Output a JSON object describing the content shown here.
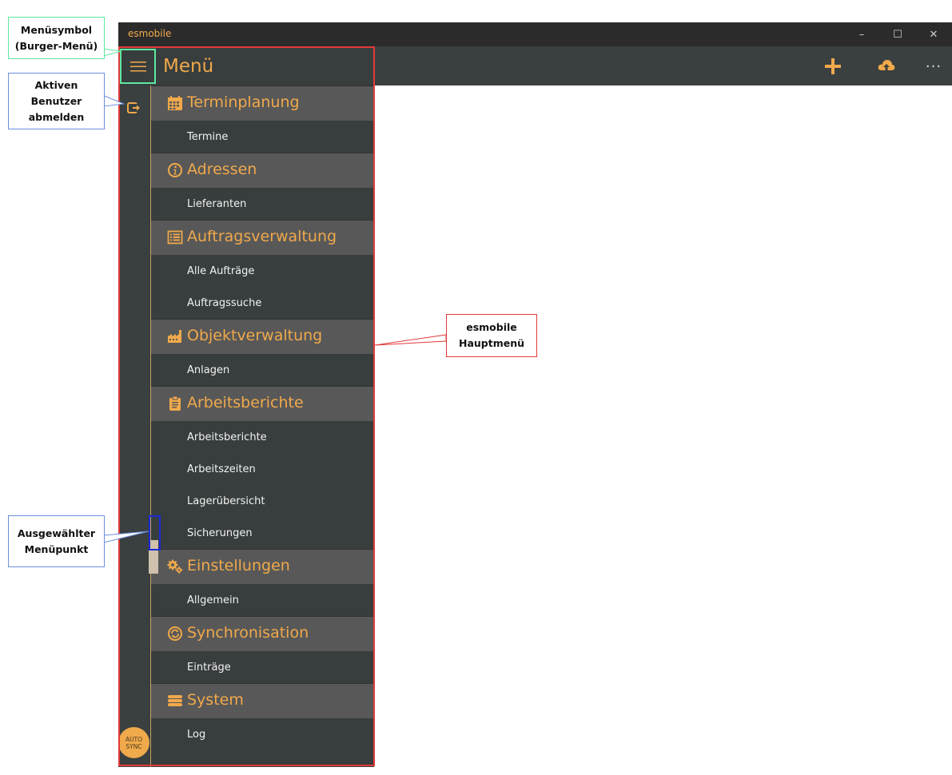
{
  "window": {
    "app_title": "esmobile",
    "controls": {
      "minimize": "–",
      "maximize": "☐",
      "close": "✕"
    }
  },
  "header": {
    "actions": [
      {
        "name": "add-icon"
      },
      {
        "name": "cloud-upload-icon"
      },
      {
        "name": "more-icon",
        "glyph": "···"
      }
    ]
  },
  "pane": {
    "title": "Menü",
    "autosync": {
      "line1": "AUTO",
      "line2": "SYNC"
    }
  },
  "menu": [
    {
      "label": "Terminplanung",
      "icon": "calendar-icon",
      "items": [
        "Termine"
      ]
    },
    {
      "label": "Adressen",
      "icon": "info-icon",
      "items": [
        "Lieferanten"
      ]
    },
    {
      "label": "Auftragsverwaltung",
      "icon": "list-icon",
      "items": [
        "Alle Aufträge",
        "Auftragssuche"
      ]
    },
    {
      "label": "Objektverwaltung",
      "icon": "factory-icon",
      "items": [
        "Anlagen"
      ]
    },
    {
      "label": "Arbeitsberichte",
      "icon": "clipboard-icon",
      "items": [
        "Arbeitsberichte",
        "Arbeitszeiten",
        "Lagerübersicht",
        "Sicherungen"
      ]
    },
    {
      "label": "Einstellungen",
      "icon": "gears-icon",
      "items": [
        "Allgemein"
      ]
    },
    {
      "label": "Synchronisation",
      "icon": "sync-icon",
      "items": [
        "Einträge"
      ]
    },
    {
      "label": "System",
      "icon": "database-icon",
      "items": [
        "Log"
      ]
    }
  ],
  "annotations": {
    "burger": {
      "line1": "Menüsymbol",
      "line2": "(Burger-Menü)"
    },
    "logout": {
      "line1": "Aktiven",
      "line2": "Benutzer",
      "line3": "abmelden"
    },
    "mainmenu": {
      "line1": "esmobile",
      "line2": "Hauptmenü"
    },
    "selected": {
      "line1": "Ausgewählter",
      "line2": "Menüpunkt"
    }
  },
  "colors": {
    "accent": "#f0a94b",
    "pane": "#383d3d",
    "group": "#585858",
    "titlebar": "#2b2b2b",
    "callout_green": "#5de8a0",
    "callout_blue": "#6b8fe0",
    "callout_red": "#e23a3a"
  }
}
